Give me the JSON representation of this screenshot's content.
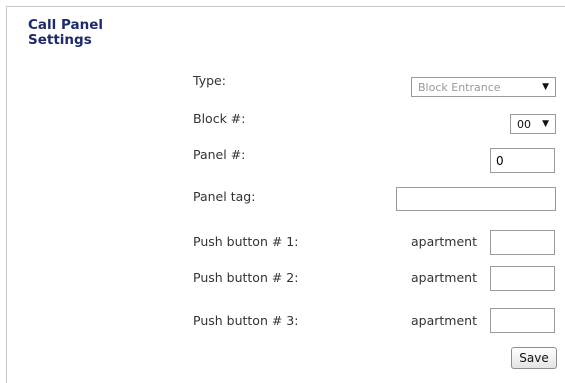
{
  "header": {
    "title": "Call Panel Settings"
  },
  "fields": {
    "type": {
      "label": "Type:",
      "value": "Block Entrance"
    },
    "block": {
      "label": "Block #:",
      "value": "00"
    },
    "panel": {
      "label": "Panel #:",
      "value": "0"
    },
    "panel_tag": {
      "label": "Panel tag:",
      "value": ""
    }
  },
  "push_buttons": [
    {
      "label": "Push button # 1:",
      "apartment_label": "apartment",
      "value": ""
    },
    {
      "label": "Push button # 2:",
      "apartment_label": "apartment",
      "value": ""
    },
    {
      "label": "Push button # 3:",
      "apartment_label": "apartment",
      "value": ""
    }
  ],
  "actions": {
    "save_label": "Save"
  }
}
